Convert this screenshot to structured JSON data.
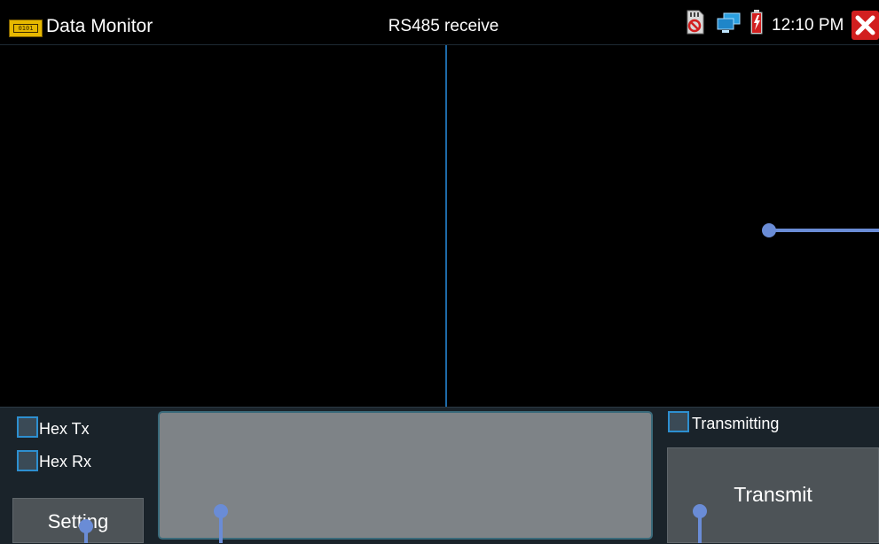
{
  "header": {
    "app_icon_text": "0101",
    "app_title": "Data Monitor",
    "center_title": "RS485 receive",
    "time": "12:10 PM",
    "icons": [
      "sd-card-missing-icon",
      "network-icon",
      "battery-charging-icon",
      "close-icon"
    ]
  },
  "options": {
    "hex_tx_label": "Hex Tx",
    "hex_rx_label": "Hex Rx",
    "transmitting_label": "Transmitting",
    "hex_tx_checked": false,
    "hex_rx_checked": false,
    "transmitting_checked": false
  },
  "send_input": {
    "value": "",
    "placeholder": ""
  },
  "buttons": {
    "setting_label": "Setting",
    "transmit_label": "Transmit"
  },
  "colors": {
    "background": "#000000",
    "divider": "#1e6aa8",
    "callout": "#6a8cd6",
    "button": "#4d5357",
    "close": "#d21f1f"
  }
}
